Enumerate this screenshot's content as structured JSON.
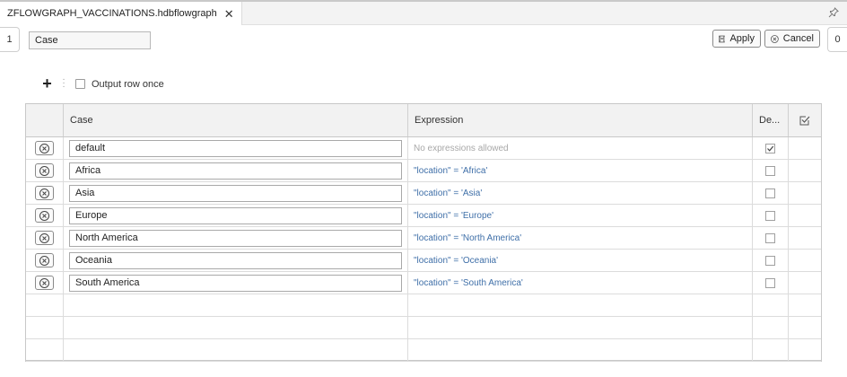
{
  "tab": {
    "title": "ZFLOWGRAPH_VACCINATIONS.hdbflowgraph",
    "close_glyph": "✕"
  },
  "side": {
    "left_label": "1",
    "right_label": "0"
  },
  "node": {
    "name": "Case"
  },
  "buttons": {
    "apply": "Apply",
    "cancel": "Cancel"
  },
  "toolbar": {
    "add_glyph": "+",
    "output_row_once": "Output row once",
    "output_row_once_checked": false
  },
  "table": {
    "headers": {
      "case": "Case",
      "expression": "Expression",
      "default": "De..."
    },
    "rows": [
      {
        "case": "default",
        "expression": "No expressions allowed",
        "muted": true,
        "default": true
      },
      {
        "case": "Africa",
        "expression": "\"location\" = 'Africa'",
        "muted": false,
        "default": false
      },
      {
        "case": "Asia",
        "expression": "\"location\" = 'Asia'",
        "muted": false,
        "default": false
      },
      {
        "case": "Europe",
        "expression": "\"location\" = 'Europe'",
        "muted": false,
        "default": false
      },
      {
        "case": "North America",
        "expression": "\"location\" = 'North America'",
        "muted": false,
        "default": false
      },
      {
        "case": "Oceania",
        "expression": "\"location\" = 'Oceania'",
        "muted": false,
        "default": false
      },
      {
        "case": "South America",
        "expression": "\"location\" = 'South America'",
        "muted": false,
        "default": false
      }
    ],
    "empty_rows": 3
  },
  "icons": {
    "pin": "pin-icon",
    "save": "save-icon",
    "cancel": "circle-x-icon",
    "delete": "circle-x-icon",
    "select_all": "checklist-icon",
    "more": "vertical-dots-icon"
  }
}
